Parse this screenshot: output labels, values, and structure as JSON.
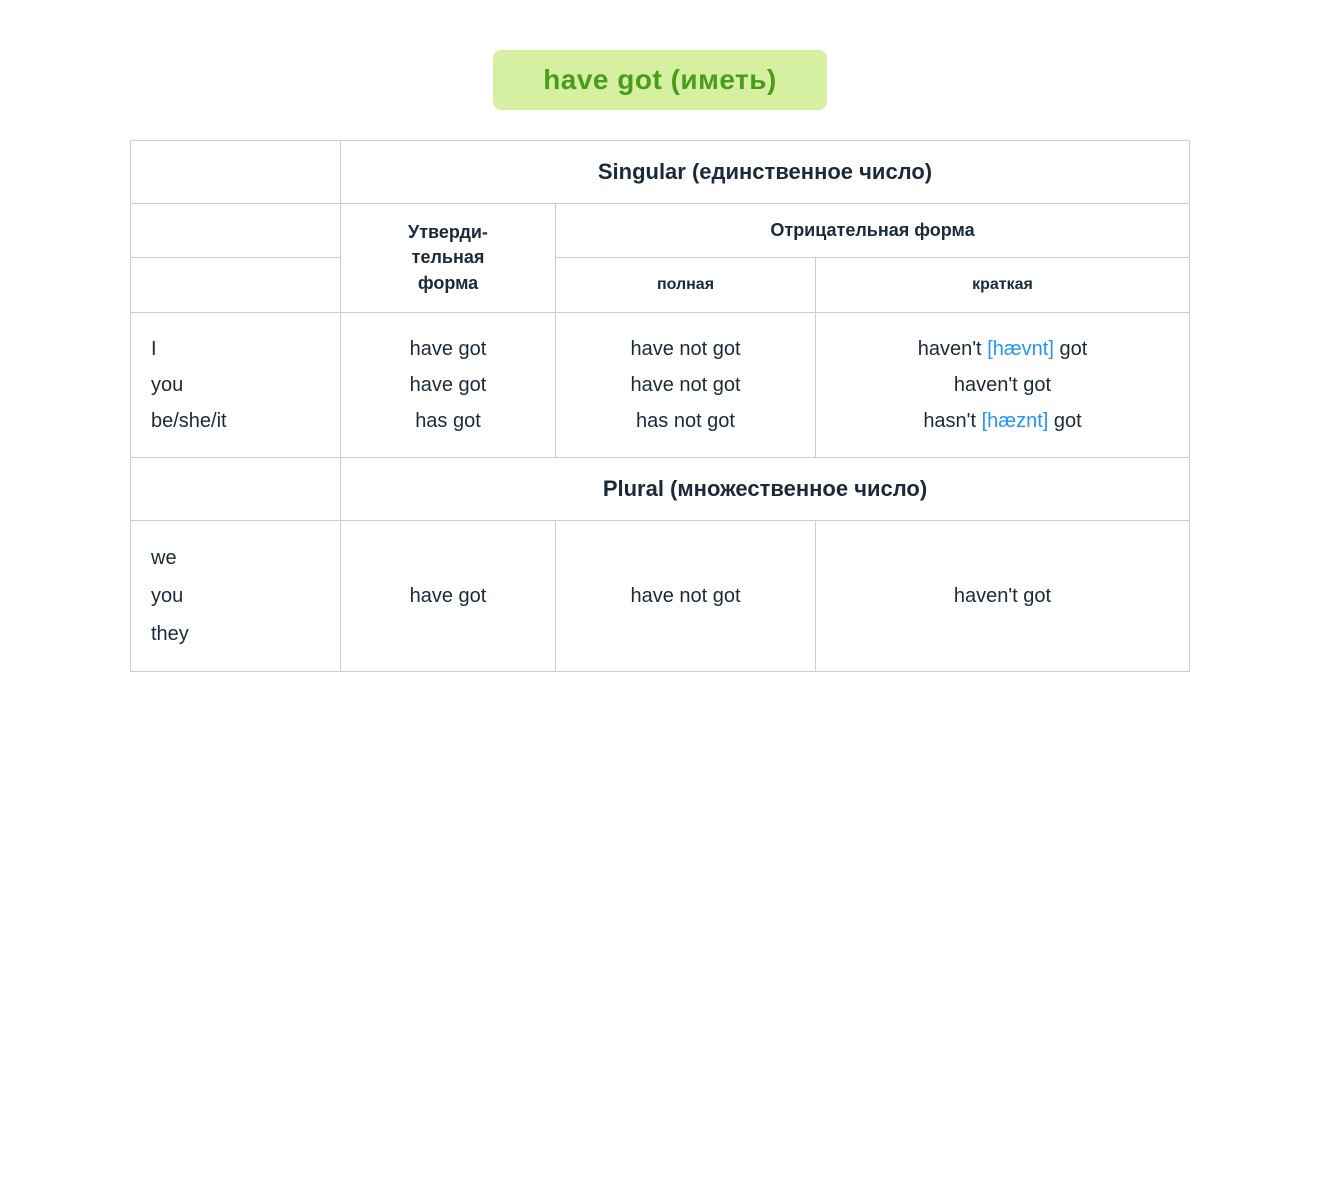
{
  "title": {
    "text": "have got (иметь)",
    "color": "#d4f0a0"
  },
  "table": {
    "singular_header": "Singular (единственное число)",
    "plural_header": "Plural (множественное число)",
    "affirmative_header_line1": "Утверди-",
    "affirmative_header_line2": "тельная",
    "affirmative_header_line3": "форма",
    "negative_header": "Отрицательная форма",
    "negative_full_subheader": "полная",
    "negative_short_subheader": "краткая",
    "singular_rows": [
      {
        "pronoun": "I",
        "affirmative": "have got",
        "negative_full": "have not got",
        "negative_short_prefix": "haven't",
        "negative_short_phonetic": "[hævnt]",
        "negative_short_suffix": "got"
      },
      {
        "pronoun": "you",
        "affirmative": "have got",
        "negative_full": "have not got",
        "negative_short_prefix": "haven't got",
        "negative_short_phonetic": "",
        "negative_short_suffix": ""
      },
      {
        "pronoun": "be/she/it",
        "affirmative": "has got",
        "negative_full": "has not got",
        "negative_short_prefix": "hasn't",
        "negative_short_phonetic": "[hæznt]",
        "negative_short_suffix": "got"
      }
    ],
    "plural_rows": [
      {
        "pronouns": [
          "we",
          "you",
          "they"
        ],
        "affirmative": "have got",
        "negative_full": "have not got",
        "negative_short": "haven't got"
      }
    ]
  }
}
